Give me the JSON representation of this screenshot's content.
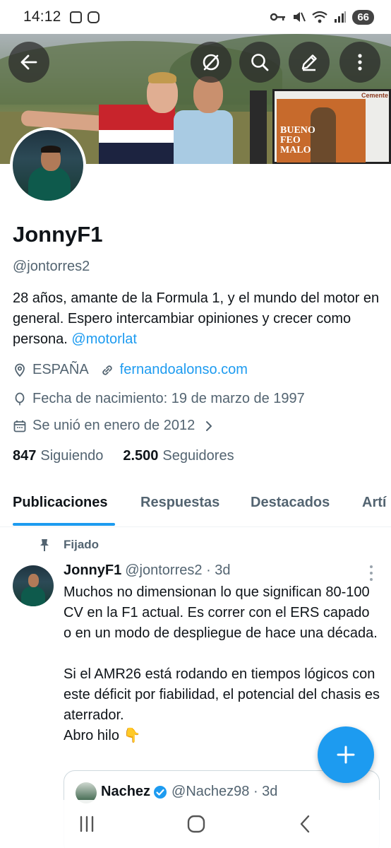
{
  "status_bar": {
    "time": "14:12",
    "battery": "66",
    "left_icons": [
      "screenshot-icon",
      "instagram-icon"
    ],
    "right_icons": [
      "key-icon",
      "mute-icon",
      "wifi-icon",
      "signal-icon"
    ]
  },
  "header_nav": {
    "back_icon": "back-arrow-icon",
    "grok_icon": "grok-icon",
    "search_icon": "search-icon",
    "compose_icon": "edit-icon",
    "more_icon": "more-vertical-icon"
  },
  "banner": {
    "poster_text": "BUENO\nFEO\nMALO",
    "sign_title": "Cemente"
  },
  "profile": {
    "display_name": "JonnyF1",
    "handle": "@jontorres2",
    "bio_text": "28 años, amante de la Formula 1, y el mundo del motor en general. Espero intercambiar opiniones y crecer como persona. ",
    "bio_mention": "@motorlat",
    "location": "ESPAÑA",
    "website": "fernandoalonso.com",
    "birthday": "Fecha de nacimiento: 19 de marzo de 1997",
    "joined": "Se unió en enero de 2012",
    "following_count": "847",
    "following_label": "Siguiendo",
    "followers_count": "2.500",
    "followers_label": "Seguidores"
  },
  "tabs": [
    {
      "label": "Publicaciones",
      "active": true
    },
    {
      "label": "Respuestas",
      "active": false
    },
    {
      "label": "Destacados",
      "active": false
    },
    {
      "label": "Artí",
      "active": false
    }
  ],
  "pinned_post": {
    "pinned_label": "Fijado",
    "author_name": "JonnyF1",
    "author_handle": "@jontorres2",
    "time": "· 3d",
    "text": "Muchos no dimensionan lo que significan 80-100 CV en la F1 actual. Es correr con el ERS capado o en un modo de despliegue de hace una década.\n\nSi el AMR26 está rodando en tiempos lógicos con este déficit por fiabilidad, el potencial del chasis es aterrador.\nAbro hilo 👇",
    "quote": {
      "author_name": "Nachez",
      "author_handle": "@Nachez98",
      "time": "· 3d",
      "verified": true
    }
  },
  "fab": {
    "icon": "plus-icon"
  },
  "system_nav": {
    "icons": [
      "recents-icon",
      "home-icon",
      "back-icon"
    ]
  },
  "colors": {
    "accent": "#1d9bf0",
    "text_primary": "#0f1419",
    "text_secondary": "#536471"
  }
}
